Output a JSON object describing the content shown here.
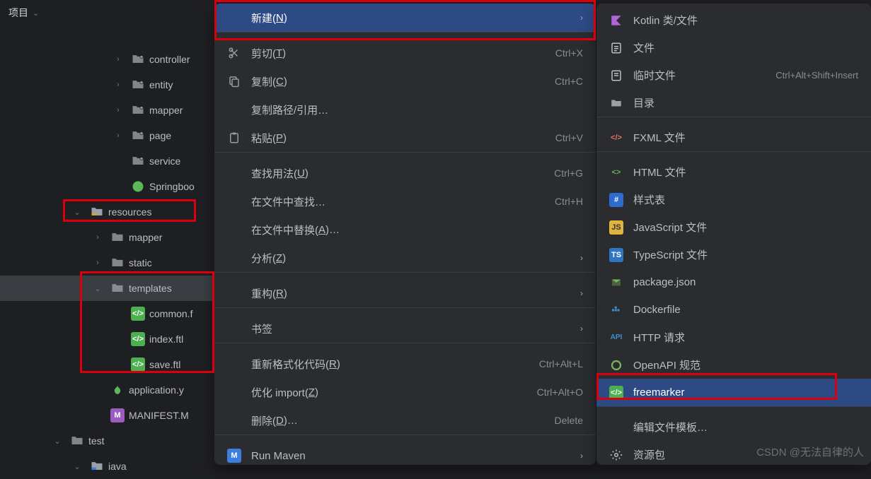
{
  "panel": {
    "title": "项目"
  },
  "tree": [
    {
      "indent": 155,
      "chev": "right",
      "icon": "folder-dot",
      "label": "controller"
    },
    {
      "indent": 155,
      "chev": "right",
      "icon": "folder-dot",
      "label": "entity"
    },
    {
      "indent": 155,
      "chev": "right",
      "icon": "folder-dot",
      "label": "mapper"
    },
    {
      "indent": 155,
      "chev": "right",
      "icon": "folder-dot",
      "label": "page"
    },
    {
      "indent": 155,
      "chev": "",
      "icon": "folder-dot",
      "label": "service"
    },
    {
      "indent": 155,
      "chev": "",
      "icon": "spring",
      "label": "Springboo"
    },
    {
      "indent": 97,
      "chev": "down",
      "icon": "folder-res",
      "label": "resources"
    },
    {
      "indent": 126,
      "chev": "right",
      "icon": "folder",
      "label": "mapper"
    },
    {
      "indent": 126,
      "chev": "right",
      "icon": "folder",
      "label": "static"
    },
    {
      "indent": 126,
      "chev": "down",
      "icon": "folder",
      "label": "templates",
      "selected": true
    },
    {
      "indent": 155,
      "chev": "",
      "icon": "ftl",
      "label": "common.f"
    },
    {
      "indent": 155,
      "chev": "",
      "icon": "ftl",
      "label": "index.ftl"
    },
    {
      "indent": 155,
      "chev": "",
      "icon": "ftl",
      "label": "save.ftl"
    },
    {
      "indent": 126,
      "chev": "",
      "icon": "yml",
      "label": "application.y"
    },
    {
      "indent": 126,
      "chev": "",
      "icon": "manifest",
      "label": "MANIFEST.M"
    },
    {
      "indent": 69,
      "chev": "down",
      "icon": "folder",
      "label": "test"
    },
    {
      "indent": 97,
      "chev": "down",
      "icon": "folder-src",
      "label": "iava"
    }
  ],
  "menu": [
    {
      "icon": "",
      "label": "新建(",
      "u": "N",
      "after": ")",
      "arrow": true,
      "sel": true
    },
    {
      "sep": true
    },
    {
      "icon": "cut",
      "label": "剪切(",
      "u": "T",
      "after": ")",
      "shortcut": "Ctrl+X"
    },
    {
      "icon": "copy",
      "label": "复制(",
      "u": "C",
      "after": ")",
      "shortcut": "Ctrl+C"
    },
    {
      "icon": "",
      "label": "复制路径/引用…",
      "shortcut": ""
    },
    {
      "icon": "paste",
      "label": "粘贴(",
      "u": "P",
      "after": ")",
      "shortcut": "Ctrl+V"
    },
    {
      "sep": true
    },
    {
      "icon": "",
      "label": "查找用法(",
      "u": "U",
      "after": ")",
      "shortcut": "Ctrl+G"
    },
    {
      "icon": "",
      "label": "在文件中查找…",
      "shortcut": "Ctrl+H"
    },
    {
      "icon": "",
      "label": "在文件中替换(",
      "u": "A",
      "after": ")…",
      "shortcut": ""
    },
    {
      "icon": "",
      "label": "分析(",
      "u": "Z",
      "after": ")",
      "arrow": true
    },
    {
      "sep": true
    },
    {
      "icon": "",
      "label": "重构(",
      "u": "R",
      "after": ")",
      "arrow": true
    },
    {
      "sep": true
    },
    {
      "icon": "",
      "label": "书签",
      "arrow": true
    },
    {
      "sep": true
    },
    {
      "icon": "",
      "label": "重新格式化代码(",
      "u": "R",
      "after": ")",
      "shortcut": "Ctrl+Alt+L"
    },
    {
      "icon": "",
      "label": "优化 import(",
      "u": "Z",
      "after": ")",
      "shortcut": "Ctrl+Alt+O"
    },
    {
      "icon": "",
      "label": "删除(",
      "u": "D",
      "after": ")…",
      "shortcut": "Delete"
    },
    {
      "sep": true
    },
    {
      "icon": "maven",
      "label": "Run Maven",
      "arrow": true
    }
  ],
  "submenu": [
    {
      "icon": "kotlin",
      "label": "Kotlin 类/文件"
    },
    {
      "icon": "file-lines",
      "label": "文件"
    },
    {
      "icon": "scratch",
      "label": "临时文件",
      "shortcut": "Ctrl+Alt+Shift+Insert"
    },
    {
      "icon": "folder-new",
      "label": "目录"
    },
    {
      "sep": true
    },
    {
      "icon": "fxml",
      "label": "FXML 文件"
    },
    {
      "sep": true
    },
    {
      "icon": "html",
      "label": "HTML 文件"
    },
    {
      "icon": "css",
      "label": "样式表"
    },
    {
      "icon": "js",
      "label": "JavaScript 文件"
    },
    {
      "icon": "ts",
      "label": "TypeScript 文件"
    },
    {
      "icon": "npm",
      "label": "package.json"
    },
    {
      "icon": "docker",
      "label": "Dockerfile"
    },
    {
      "icon": "api",
      "label": "HTTP 请求"
    },
    {
      "icon": "openapi",
      "label": "OpenAPI 规范"
    },
    {
      "icon": "ftl",
      "label": "freemarker",
      "sel": true
    },
    {
      "sep": true
    },
    {
      "icon": "",
      "label": "编辑文件模板…"
    },
    {
      "icon": "gear",
      "label": "资源包"
    }
  ],
  "watermark": "CSDN @无法自律的人"
}
